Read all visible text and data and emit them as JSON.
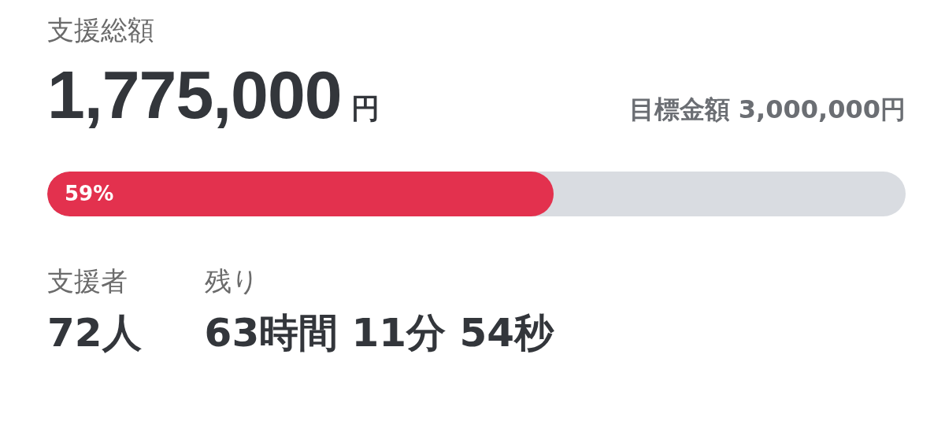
{
  "total": {
    "label": "支援総額",
    "amount": "1,775,000",
    "unit": "円",
    "goal": "目標金額 3,000,000円"
  },
  "progress": {
    "level": 0.59,
    "percent": "59%"
  },
  "stats": [
    {
      "label": "支援者",
      "value": "72人"
    },
    {
      "label": "残り",
      "value": "63時間 11分 54秒"
    }
  ]
}
